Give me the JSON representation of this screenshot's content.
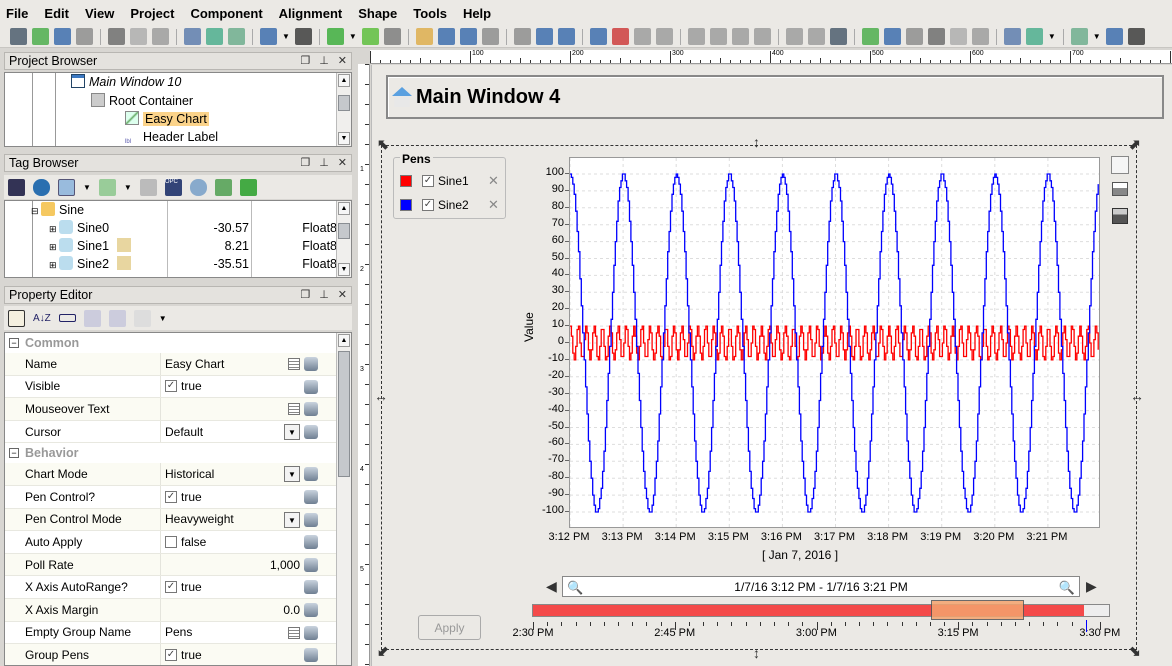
{
  "menu": [
    "File",
    "Edit",
    "View",
    "Project",
    "Component",
    "Alignment",
    "Shape",
    "Tools",
    "Help"
  ],
  "toolbar_icons": [
    "save-icon",
    "refresh-icon",
    "undo-icon",
    "redo-icon",
    "|",
    "cut-icon",
    "copy-icon",
    "paste-icon",
    "|",
    "disconnect-icon",
    "preview-comm-icon",
    "read-write-icon",
    "|",
    "new-window-icon",
    "dropdown-icon",
    "run-icon",
    "|",
    "publish-icon",
    "dropdown-icon",
    "settings-icon",
    "lock-icon",
    "|",
    "fit-icon",
    "select-icon",
    "group-icon",
    "ungroup-icon",
    "|",
    "zoom-in-icon",
    "zoom-out-icon",
    "zoom-actual-icon",
    "|",
    "align-top-icon",
    "align-left-icon",
    "align-bottom-icon",
    "align-right-icon",
    "|",
    "flip-h-icon",
    "flip-v-icon",
    "rotate-left-icon",
    "rotate-right-icon",
    "|",
    "shape-union-icon",
    "shape-difference-icon",
    "shape-intersect-icon",
    "|",
    "align-left-edge-icon",
    "align-center-icon",
    "align-right-edge-icon",
    "align-top-edge-icon",
    "align-middle-icon",
    "align-bottom-edge-icon",
    "|",
    "distribute-h-icon",
    "distribute-v-icon",
    "dropdown-icon",
    "|",
    "space-icon",
    "dropdown-icon",
    "width-icon",
    "height-icon"
  ],
  "project_browser": {
    "title": "Project Browser",
    "items": [
      "Main Window 10",
      "Root Container",
      "Easy Chart",
      "Header Label"
    ]
  },
  "tag_browser": {
    "title": "Tag Browser",
    "folder": "Sine",
    "rows": [
      {
        "name": "Sine0",
        "value": "-30.57",
        "type": "Float8"
      },
      {
        "name": "Sine1",
        "value": "8.21",
        "type": "Float8"
      },
      {
        "name": "Sine2",
        "value": "-35.51",
        "type": "Float8"
      }
    ]
  },
  "property_editor": {
    "title": "Property Editor",
    "groups": [
      {
        "name": "Common",
        "rows": [
          {
            "name": "Name",
            "value": "Easy Chart",
            "kind": "edit"
          },
          {
            "name": "Visible",
            "value": "true",
            "kind": "check",
            "checked": true
          },
          {
            "name": "Mouseover Text",
            "value": "",
            "kind": "edit"
          },
          {
            "name": "Cursor",
            "value": "Default",
            "kind": "drop"
          }
        ]
      },
      {
        "name": "Behavior",
        "rows": [
          {
            "name": "Chart Mode",
            "value": "Historical",
            "kind": "drop"
          },
          {
            "name": "Pen Control?",
            "value": "true",
            "kind": "check",
            "checked": true
          },
          {
            "name": "Pen Control Mode",
            "value": "Heavyweight",
            "kind": "drop"
          },
          {
            "name": "Auto Apply",
            "value": "false",
            "kind": "check",
            "checked": false
          },
          {
            "name": "Poll Rate",
            "value": "1,000",
            "kind": "num"
          },
          {
            "name": "X Axis AutoRange?",
            "value": "true",
            "kind": "check",
            "checked": true
          },
          {
            "name": "X Axis Margin",
            "value": "0.0",
            "kind": "num"
          },
          {
            "name": "Empty Group Name",
            "value": "Pens",
            "kind": "edit"
          },
          {
            "name": "Group Pens",
            "value": "true",
            "kind": "check",
            "checked": true
          }
        ]
      }
    ]
  },
  "ruler": {
    "h_labels": [
      "100",
      "200",
      "300",
      "400",
      "500",
      "600",
      "700"
    ],
    "v_labels": [
      "1",
      "2",
      "3",
      "4",
      "5"
    ]
  },
  "window_title": "Main Window 4",
  "pens": {
    "title": "Pens",
    "items": [
      {
        "name": "Sine1",
        "color": "#ff0000",
        "checked": true
      },
      {
        "name": "Sine2",
        "color": "#0000ff",
        "checked": true
      }
    ]
  },
  "chart_data": {
    "type": "line",
    "ylabel": "Value",
    "xlabel": "[ Jan 7, 2016 ]",
    "ylim": [
      -100,
      100
    ],
    "xlim": [
      "3:12 PM",
      "3:22 PM"
    ],
    "yticks": [
      "100",
      "90",
      "80",
      "70",
      "60",
      "50",
      "40",
      "30",
      "20",
      "10",
      "0",
      "-10",
      "-20",
      "-30",
      "-40",
      "-50",
      "-60",
      "-70",
      "-80",
      "-90",
      "-100"
    ],
    "xticks": [
      "3:12 PM",
      "3:13 PM",
      "3:14 PM",
      "3:15 PM",
      "3:16 PM",
      "3:17 PM",
      "3:18 PM",
      "3:19 PM",
      "3:20 PM",
      "3:21 PM"
    ],
    "grid": true,
    "series": [
      {
        "name": "Sine1",
        "color": "#ff0000",
        "shape": "stepped sine",
        "amplitude": 10,
        "period_seconds": 9,
        "start": "3:12 PM",
        "end": "3:21:57 PM"
      },
      {
        "name": "Sine2",
        "color": "#0000ff",
        "shape": "stepped sine",
        "amplitude": 100,
        "period_seconds": 60,
        "peak_at": "3:12 PM",
        "start": "3:12 PM",
        "end": "3:21:57 PM"
      }
    ]
  },
  "range": {
    "text": "1/7/16 3:12 PM - 1/7/16 3:21 PM"
  },
  "timeline": {
    "labels": [
      "2:30 PM",
      "2:45 PM",
      "3:00 PM",
      "3:15 PM",
      "3:30 PM"
    ],
    "data_color": "#f44a4a",
    "selection_color": "#f5a36e"
  },
  "apply_label": "Apply"
}
